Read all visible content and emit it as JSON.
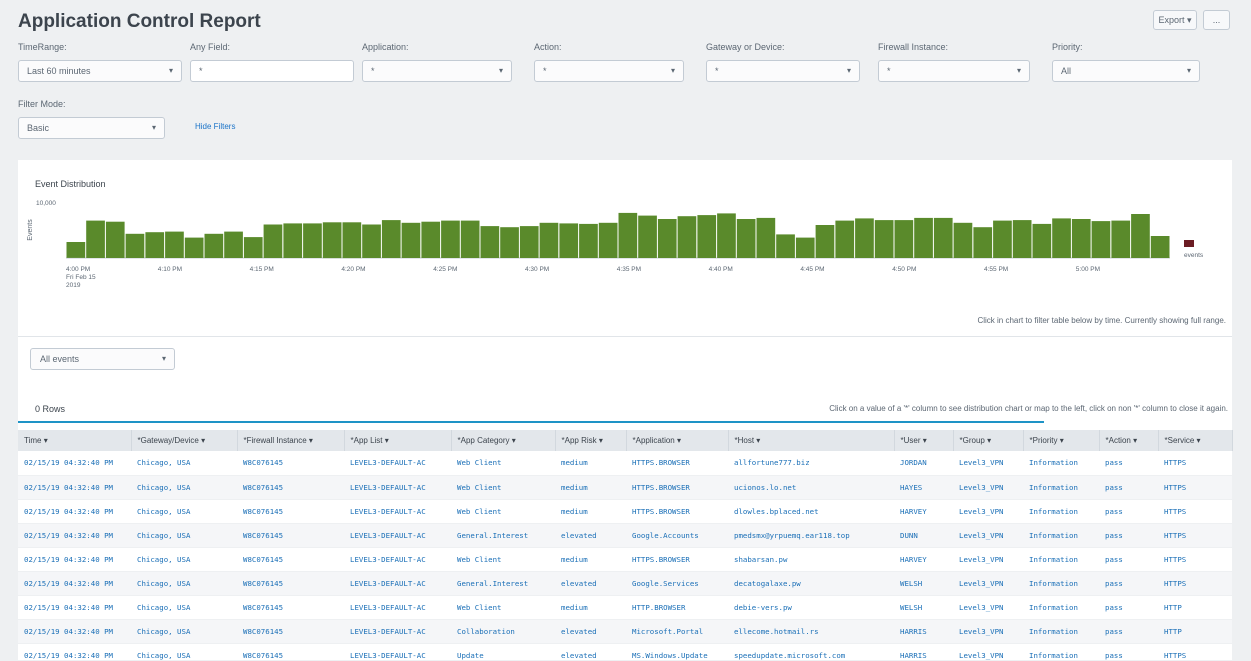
{
  "header": {
    "title": "Application Control Report",
    "export_label": "Export ▾",
    "more_label": "..."
  },
  "filters": {
    "time_range": {
      "label": "TimeRange:",
      "value": "Last 60 minutes"
    },
    "any_field": {
      "label": "Any Field:",
      "value": "*"
    },
    "application": {
      "label": "Application:",
      "value": "*"
    },
    "action": {
      "label": "Action:",
      "value": "*"
    },
    "gateway": {
      "label": "Gateway or Device:",
      "value": "*"
    },
    "firewall": {
      "label": "Firewall Instance:",
      "value": "*"
    },
    "priority": {
      "label": "Priority:",
      "value": "All"
    },
    "filter_mode": {
      "label": "Filter Mode:",
      "value": "Basic"
    },
    "hide_filters": "Hide Filters"
  },
  "chart_panel": {
    "title": "Event Distribution",
    "hint": "Click in chart to filter table below by time. Currently showing full range."
  },
  "chart_data": {
    "type": "bar",
    "ylabel": "Events",
    "yaxis_top_label": "10,000",
    "legend": "events",
    "series_color": "#5a8a2b",
    "legend_color": "#6b1c23",
    "x_tick_labels": [
      "4:00 PM\nFri Feb 15\n2019",
      "4:10 PM",
      "4:15 PM",
      "4:20 PM",
      "4:25 PM",
      "4:30 PM",
      "4:35 PM",
      "4:40 PM",
      "4:45 PM",
      "4:50 PM",
      "4:55 PM",
      "5:00 PM"
    ],
    "values": [
      1450,
      3400,
      3300,
      2200,
      2350,
      2400,
      1850,
      2200,
      2400,
      1900,
      3050,
      3150,
      3150,
      3250,
      3250,
      3050,
      3450,
      3200,
      3300,
      3400,
      3400,
      2900,
      2800,
      2900,
      3200,
      3150,
      3100,
      3200,
      4100,
      3850,
      3550,
      3800,
      3900,
      4050,
      3550,
      3650,
      2150,
      1850,
      3000,
      3400,
      3600,
      3450,
      3450,
      3650,
      3650,
      3200,
      2800,
      3400,
      3450,
      3100,
      3600,
      3550,
      3350,
      3400,
      4000,
      2000
    ]
  },
  "table_controls": {
    "events_select": "All events",
    "rows_count": "0 Rows",
    "hint": "Click on a value of a '*' column to see distribution chart or map to the left, click on non '*' column to close it again."
  },
  "table": {
    "columns": [
      "Time ▾",
      "*Gateway/Device ▾",
      "*Firewall Instance ▾",
      "*App List ▾",
      "*App Category ▾",
      "*App Risk ▾",
      "*Application ▾",
      "*Host ▾",
      "*User ▾",
      "*Group ▾",
      "*Priority ▾",
      "*Action ▾",
      "*Service ▾"
    ],
    "rows": [
      [
        "02/15/19 04:32:40 PM",
        "Chicago, USA",
        "W8C076145",
        "LEVEL3-DEFAULT-AC",
        "Web Client",
        "medium",
        "HTTPS.BROWSER",
        "allfortune777.biz",
        "JORDAN",
        "Level3_VPN",
        "Information",
        "pass",
        "HTTPS"
      ],
      [
        "02/15/19 04:32:40 PM",
        "Chicago, USA",
        "W8C076145",
        "LEVEL3-DEFAULT-AC",
        "Web Client",
        "medium",
        "HTTPS.BROWSER",
        "ucionos.lo.net",
        "HAYES",
        "Level3_VPN",
        "Information",
        "pass",
        "HTTPS"
      ],
      [
        "02/15/19 04:32:40 PM",
        "Chicago, USA",
        "W8C076145",
        "LEVEL3-DEFAULT-AC",
        "Web Client",
        "medium",
        "HTTPS.BROWSER",
        "dlowles.bplaced.net",
        "HARVEY",
        "Level3_VPN",
        "Information",
        "pass",
        "HTTPS"
      ],
      [
        "02/15/19 04:32:40 PM",
        "Chicago, USA",
        "W8C076145",
        "LEVEL3-DEFAULT-AC",
        "General.Interest",
        "elevated",
        "Google.Accounts",
        "pmedsmx@yrpuemq.ear118.top",
        "DUNN",
        "Level3_VPN",
        "Information",
        "pass",
        "HTTPS"
      ],
      [
        "02/15/19 04:32:40 PM",
        "Chicago, USA",
        "W8C076145",
        "LEVEL3-DEFAULT-AC",
        "Web Client",
        "medium",
        "HTTPS.BROWSER",
        "shabarsan.pw",
        "HARVEY",
        "Level3_VPN",
        "Information",
        "pass",
        "HTTPS"
      ],
      [
        "02/15/19 04:32:40 PM",
        "Chicago, USA",
        "W8C076145",
        "LEVEL3-DEFAULT-AC",
        "General.Interest",
        "elevated",
        "Google.Services",
        "decatogalaxe.pw",
        "WELSH",
        "Level3_VPN",
        "Information",
        "pass",
        "HTTPS"
      ],
      [
        "02/15/19 04:32:40 PM",
        "Chicago, USA",
        "W8C076145",
        "LEVEL3-DEFAULT-AC",
        "Web Client",
        "medium",
        "HTTP.BROWSER",
        "debie-vers.pw",
        "WELSH",
        "Level3_VPN",
        "Information",
        "pass",
        "HTTP"
      ],
      [
        "02/15/19 04:32:40 PM",
        "Chicago, USA",
        "W8C076145",
        "LEVEL3-DEFAULT-AC",
        "Collaboration",
        "elevated",
        "Microsoft.Portal",
        "ellecome.hotmail.rs",
        "HARRIS",
        "Level3_VPN",
        "Information",
        "pass",
        "HTTP"
      ],
      [
        "02/15/19 04:32:40 PM",
        "Chicago, USA",
        "W8C076145",
        "LEVEL3-DEFAULT-AC",
        "Update",
        "elevated",
        "MS.Windows.Update",
        "speedupdate.microsoft.com",
        "HARRIS",
        "Level3_VPN",
        "Information",
        "pass",
        "HTTPS"
      ]
    ]
  }
}
